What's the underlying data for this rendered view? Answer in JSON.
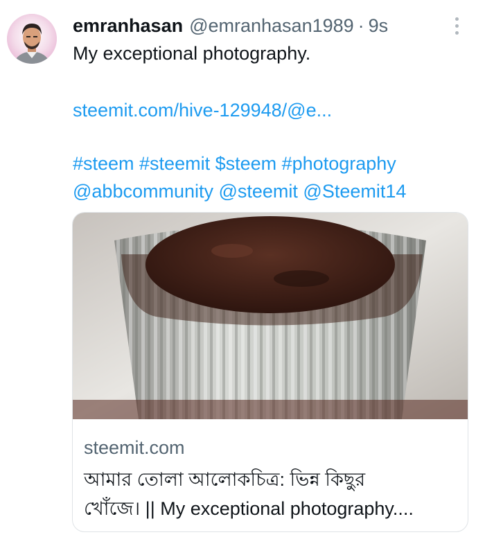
{
  "tweet": {
    "author_name": "emranhasan",
    "author_handle": "@emranhasan1989",
    "separator": "·",
    "time": "9s",
    "text": "My exceptional photography.",
    "link": "steemit.com/hive-129948/@e...",
    "hashtags_line": "#steem #steemit $steem #photography",
    "mentions_line": "@abbcommunity @steemit @Steemit14"
  },
  "icons": {
    "more": "more-vertical-icon",
    "avatar": "user-avatar"
  },
  "card": {
    "domain": "steemit.com",
    "title_line1": "আমার তোলা আলোকচিত্র: ভিন্ন কিছুর",
    "title_line2": "খোঁজে। || My exceptional photography...."
  },
  "colors": {
    "link_blue": "#1d9bf0",
    "secondary_text": "#536471",
    "primary_text": "#0f1419"
  }
}
